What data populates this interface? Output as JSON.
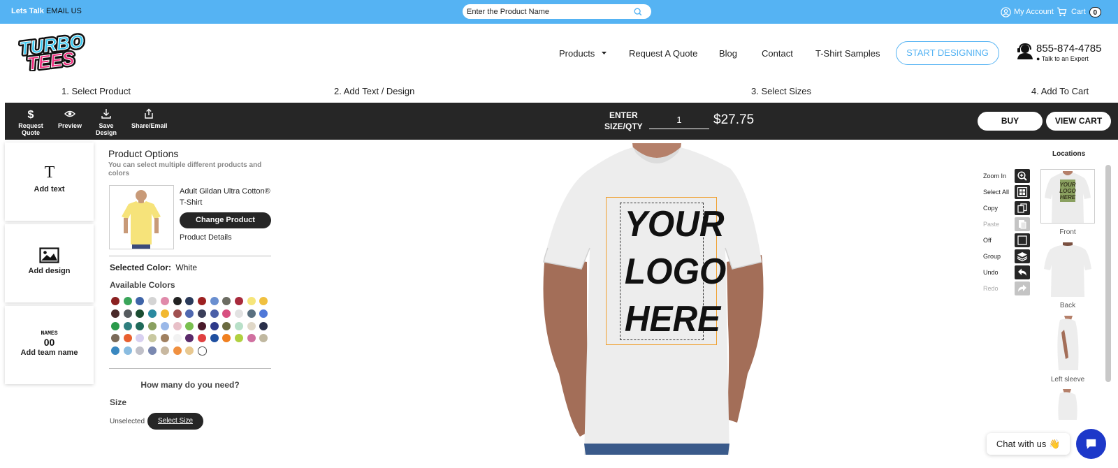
{
  "topbar": {
    "lets_talk": "Lets Talk",
    "email_us": "EMAIL US",
    "search_placeholder": "Enter the Product Name",
    "account_label": "My Account",
    "cart_label": "Cart",
    "cart_count": "0"
  },
  "header": {
    "logo_text_1": "TURBO",
    "logo_text_2": "TEES",
    "nav": {
      "products": "Products",
      "request_quote": "Request A Quote",
      "blog": "Blog",
      "contact": "Contact",
      "samples": "T-Shirt Samples"
    },
    "start_designing": "START DESIGNING",
    "phone": "855-874-4785",
    "phone_sub": "● Talk to an Expert"
  },
  "steps": [
    "1. Select Product",
    "2. Add Text / Design",
    "3. Select Sizes",
    "4. Add To Cart"
  ],
  "toolbar": {
    "request_quote": "Request Quote",
    "preview": "Preview",
    "save_design": "Save Design",
    "share_email": "Share/Email",
    "enter_line1": "ENTER",
    "enter_line2": "SIZE/QTY",
    "qty_value": "1",
    "price": "$27.75",
    "buy": "BUY",
    "view_cart": "VIEW CART"
  },
  "tools": {
    "add_text": "Add text",
    "add_design": "Add design",
    "team_icon_top": "NAMES",
    "team_icon_bottom": "00",
    "add_team_name": "Add team name"
  },
  "product_options": {
    "title": "Product Options",
    "subtitle": "You can select multiple different products and colors",
    "product_name": "Adult Gildan Ultra Cotton® T-Shirt",
    "change_product": "Change Product",
    "product_details": "Product Details",
    "selected_color_label": "Selected Color:",
    "selected_color_value": "White",
    "available_colors": "Available Colors",
    "swatches": [
      [
        "#8b2121",
        "#3aa55a",
        "#3e64a8",
        "#d4d4d4",
        "#e08aaa",
        "#222222",
        "#2a3a5a",
        "#9c2020",
        "#6a8fd0",
        "#6c6c62",
        "#a82a3c",
        "#f6e57a",
        "#f0c040"
      ],
      [
        "#4a2a2a",
        "#555b5f",
        "#1a4d32",
        "#2a8aa0",
        "#f2b830",
        "#a05050",
        "#4f68b0",
        "#3b3f5a",
        "#4a5fa8",
        "#d85080",
        "#e2e2e2",
        "#5a7080",
        "#4f78d8"
      ],
      [
        "#2a9a4a",
        "#2f7f7f",
        "#1f6a5a",
        "#8aa060",
        "#9ab8e8",
        "#e8c0c8",
        "#7ac050",
        "#4a1a2a",
        "#2e3a8a",
        "#6a6a40",
        "#b8e0c8",
        "#e0d8c8",
        "#2a2f4a"
      ],
      [
        "#7a6a58",
        "#e86030",
        "#d8d0f0",
        "#c8c8a0",
        "#a08060",
        "#f2f2f2",
        "#5a2a6a",
        "#e04040",
        "#1f4fa0",
        "#f08020",
        "#b0d040",
        "#d070a0",
        "#c0b8a0"
      ],
      [
        "#3a88c0",
        "#8abce0",
        "#c0c0c8",
        "#7a88b0",
        "#c8b8a0",
        "#f09040",
        "#e8c890",
        "#ffffff"
      ]
    ],
    "how_many": "How many do you need?",
    "size_label": "Size",
    "unselected": "Unselected",
    "select_size": "Select Size"
  },
  "design": {
    "logo_lines": [
      "YOUR",
      "LOGO",
      "HERE"
    ]
  },
  "controls": [
    {
      "label": "Zoom In",
      "icon": "zoom-in-icon",
      "disabled": false
    },
    {
      "label": "Select All",
      "icon": "select-all-icon",
      "disabled": false
    },
    {
      "label": "Copy",
      "icon": "copy-icon",
      "disabled": false
    },
    {
      "label": "Paste",
      "icon": "paste-icon",
      "disabled": true
    },
    {
      "label": "Off",
      "icon": "snap-off-icon",
      "disabled": false
    },
    {
      "label": "Group",
      "icon": "layers-icon",
      "disabled": false
    },
    {
      "label": "Undo",
      "icon": "undo-icon",
      "disabled": false
    },
    {
      "label": "Redo",
      "icon": "redo-icon",
      "disabled": true
    }
  ],
  "locations": {
    "title": "Locations",
    "front": "Front",
    "back": "Back",
    "left_sleeve": "Left sleeve"
  },
  "chat": {
    "label": "Chat with us 👋"
  },
  "colors": {
    "accent_blue": "#55b3f3",
    "toolbar_dark": "#262626",
    "chat_blue": "#1d38c9"
  }
}
